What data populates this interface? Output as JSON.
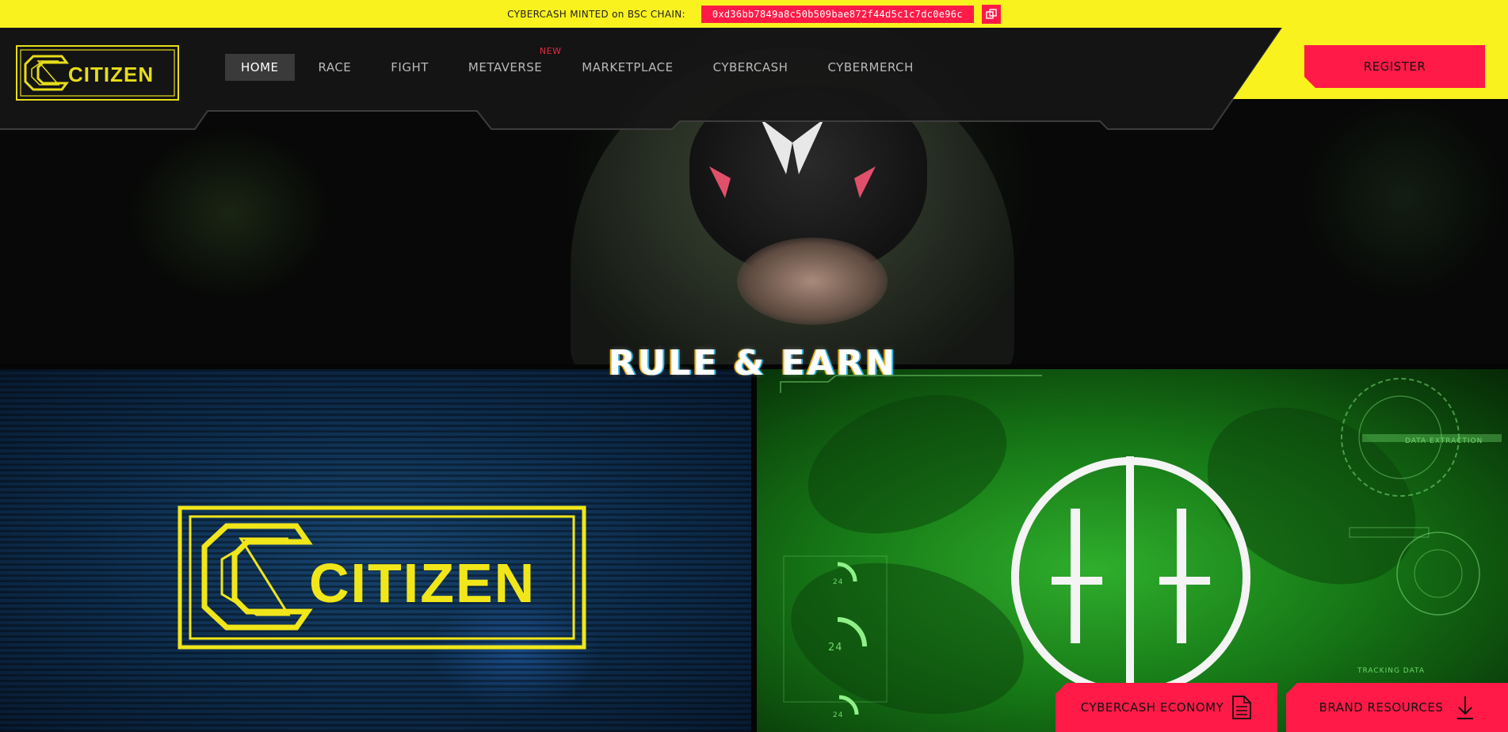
{
  "topbar": {
    "label": "CYBERCASH MINTED on BSC CHAIN:",
    "contract_address": "0xd36bb7849a8c50b509bae872f44d5c1c7dc0e96c"
  },
  "logo": {
    "text": "CITIZEN"
  },
  "nav": {
    "items": [
      {
        "label": "HOME",
        "active": true
      },
      {
        "label": "RACE"
      },
      {
        "label": "FIGHT"
      },
      {
        "label": "METAVERSE",
        "badge": "NEW"
      },
      {
        "label": "MARKETPLACE"
      },
      {
        "label": "CYBERCASH"
      },
      {
        "label": "CYBERMERCH"
      }
    ],
    "register_label": "REGISTER"
  },
  "hero": {
    "tagline": "RULE & EARN"
  },
  "panels": {
    "left_logo_text": "CITIZEN",
    "right_hud": {
      "data_extraction": "DATA EXTRACTION",
      "tracking_data": "TRACKING DATA",
      "counter": "24"
    }
  },
  "buttons": {
    "economy_label": "CYBERCASH ECONOMY",
    "brand_label": "BRAND RESOURCES"
  },
  "colors": {
    "yellow": "#f9f21f",
    "accent_red": "#ff1a47",
    "nav_bg": "#151515"
  },
  "icons": [
    "copy-icon",
    "document-icon",
    "download-icon"
  ]
}
